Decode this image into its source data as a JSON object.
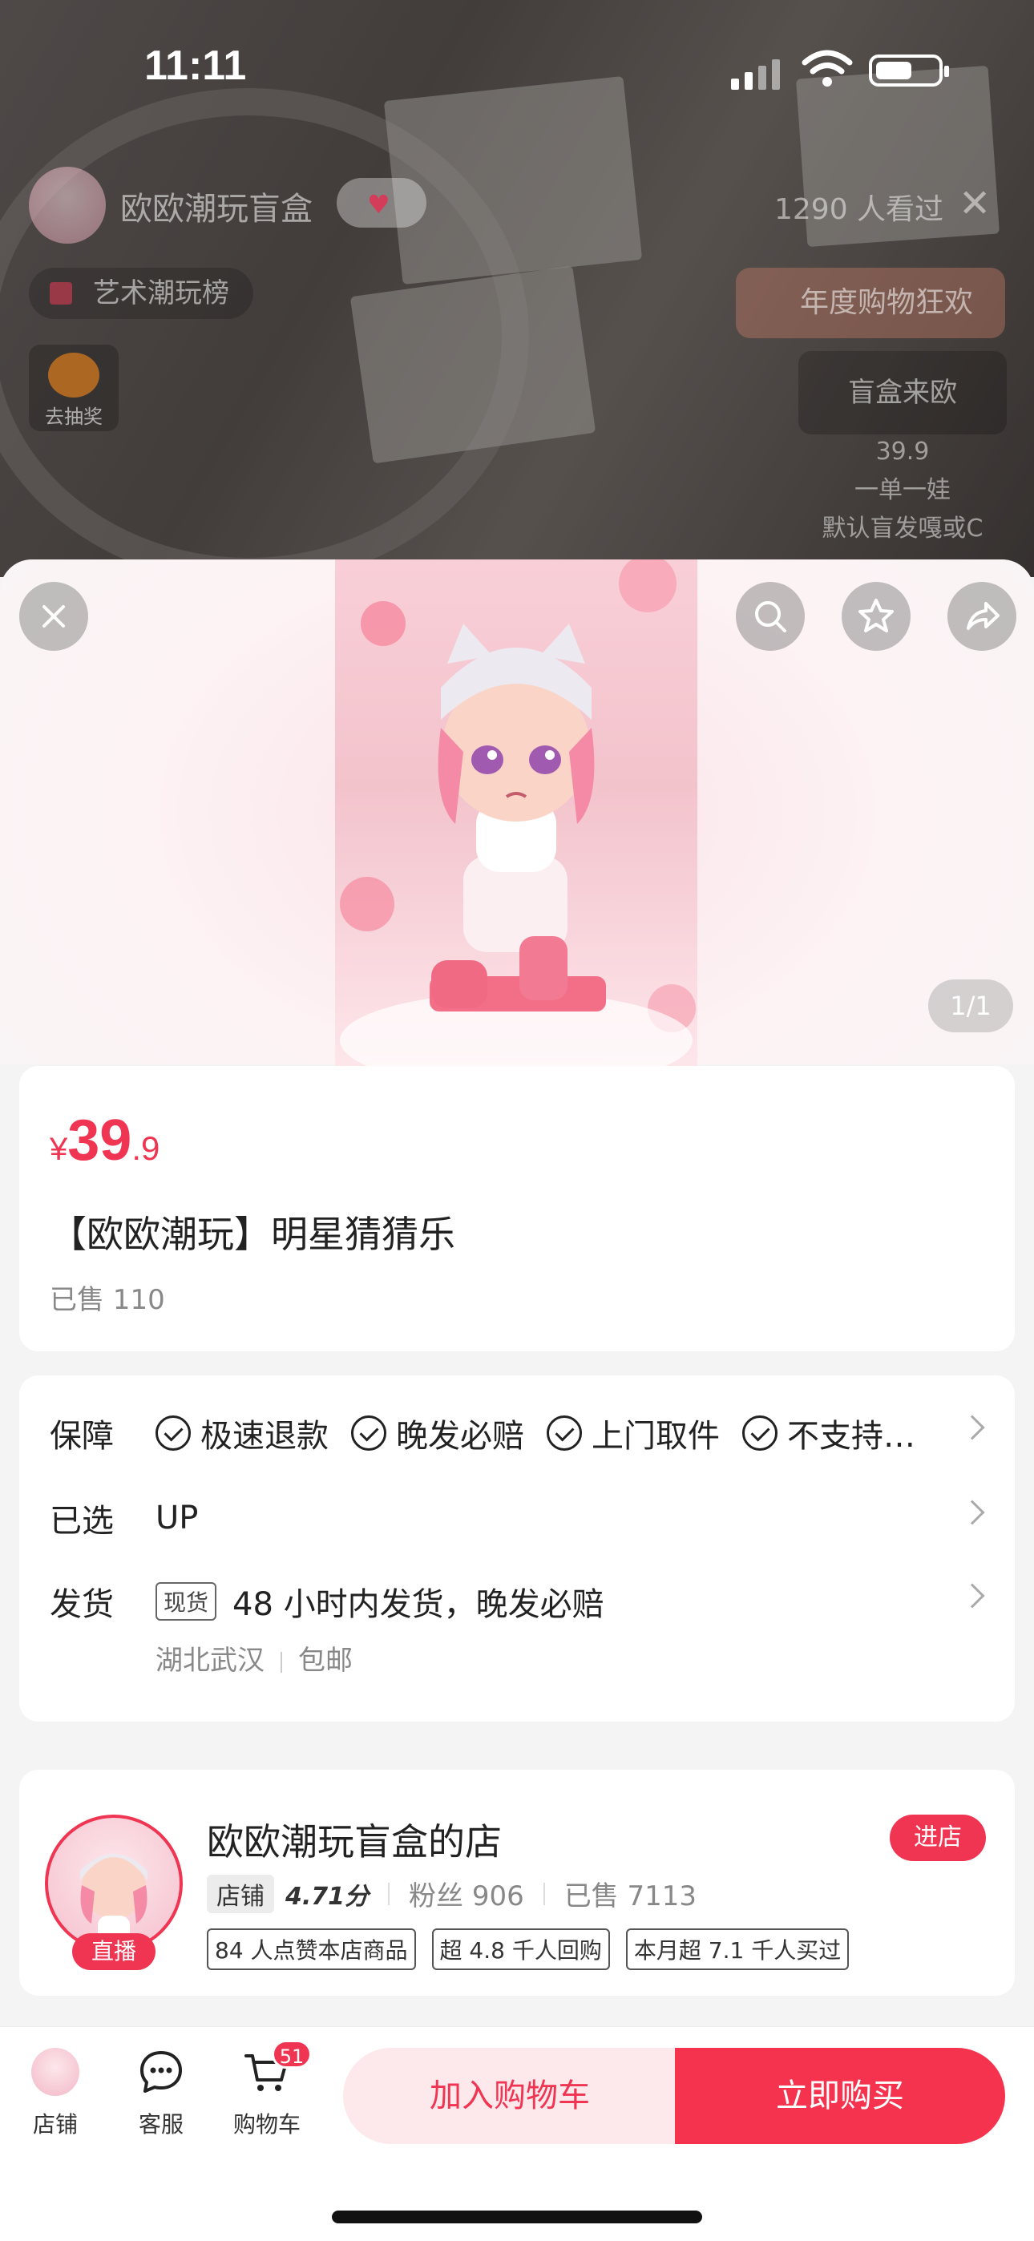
{
  "status_bar": {
    "time": "11:11"
  },
  "live": {
    "streamer_name": "欧欧潮玩盲盒",
    "viewers": "1290 人看过",
    "rank_label": "艺术潮玩榜",
    "lottery_label": "去抽奖",
    "promo_label": "年度购物狂欢",
    "side_box_label": "盲盒来欧",
    "side_lines": [
      "39.9",
      "一单一娃",
      "默认盲发嘎或C"
    ]
  },
  "gallery": {
    "pager": "1/1"
  },
  "product": {
    "currency_symbol": "¥",
    "price_int": "39",
    "price_dec": ".9",
    "title": "【欧欧潮玩】明星猜猜乐",
    "sold": "已售 110"
  },
  "details": {
    "guarantee_label": "保障",
    "guarantees": [
      "极速退款",
      "晚发必赔",
      "上门取件",
      "不支持…"
    ],
    "selected_label": "已选",
    "selected_value": "UP",
    "shipping_label": "发货",
    "shipping_tag": "现货",
    "shipping_text": "48 小时内发货，晚发必赔",
    "origin": "湖北武汉",
    "shipping_fee": "包邮"
  },
  "shop": {
    "name": "欧欧潮玩盲盒的店",
    "live_badge": "直播",
    "enter_label": "进店",
    "badge": "店铺",
    "score": "4.71分",
    "fans": "粉丝 906",
    "sold": "已售 7113",
    "tags": [
      "84 人点赞本店商品",
      "超 4.8 千人回购",
      "本月超 7.1 千人买过"
    ]
  },
  "bottom_bar": {
    "shop_label": "店铺",
    "service_label": "客服",
    "cart_label": "购物车",
    "cart_count": "51",
    "add_to_cart": "加入购物车",
    "buy_now": "立即购买"
  },
  "colors": {
    "accent": "#f03552",
    "accent_light": "#fde8eb",
    "sheet_bg": "#f4f4f5"
  }
}
